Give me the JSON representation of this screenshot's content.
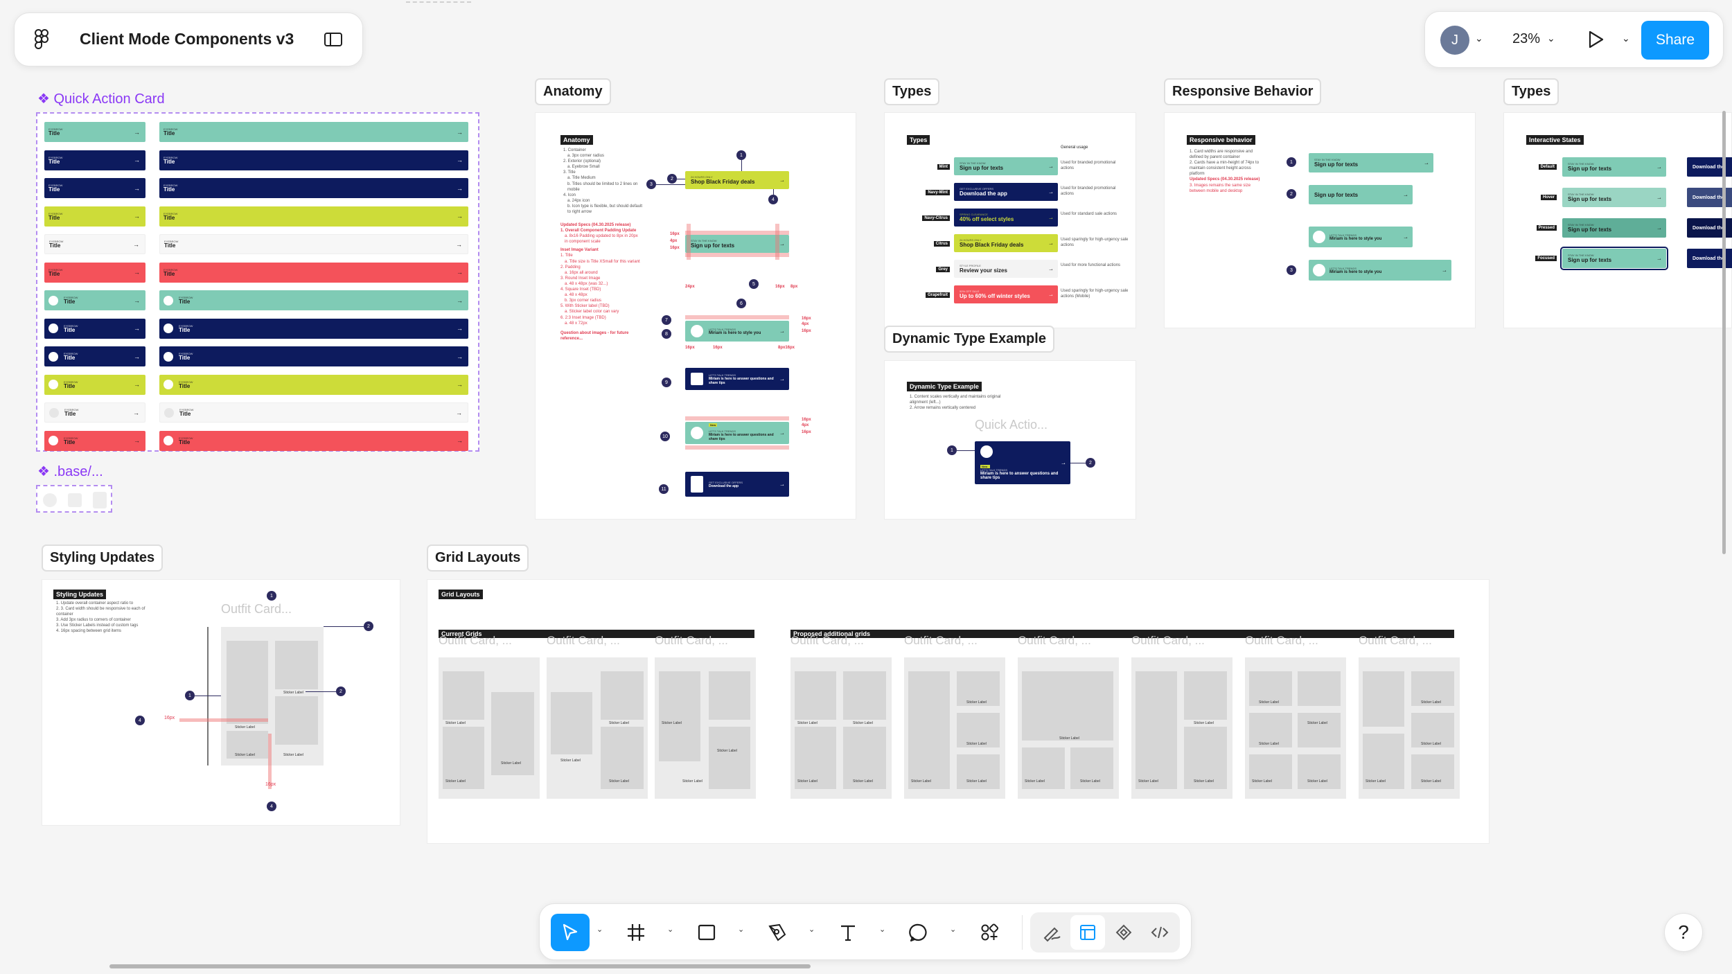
{
  "header": {
    "file_title": "Client Mode Components v3"
  },
  "topright": {
    "avatar_initial": "J",
    "zoom": "23%",
    "share_label": "Share"
  },
  "frames": {
    "quick_action": "Quick Action Card",
    "base": ".base/...",
    "anatomy": "Anatomy",
    "types": "Types",
    "responsive": "Responsive Behavior",
    "types2": "Types",
    "dynamic": "Dynamic Type Example",
    "styling": "Styling Updates",
    "grid": "Grid Layouts"
  },
  "quick_cards": {
    "eyebrow": "EYEBROW",
    "title": "Title",
    "arrow": "→"
  },
  "anatomy": {
    "title": "Anatomy",
    "notes": [
      "1. Container",
      "a. 3px corner radius",
      "2. Exterior (optional)",
      "a. Eyebrow Small",
      "3. Title",
      "a. Title Medium",
      "b. Titles should be limited to 2 lines on mobile",
      "4. Icon",
      "a. 24px icon",
      "b. Icon type is flexible, but should default to right arrow"
    ],
    "red_notes": [
      "Updated Specs (04.30.2025 release)",
      "1. Overall Component Padding Update",
      "a. 8x16 Padding updated to 8px in 20px in component scale",
      "Inset Image Variant",
      "1. Title",
      "a. Title size is Title XSmall for this variant",
      "2. Padding",
      "a. 16px all around",
      "3. Round Inset Image",
      "a. 48 x 48px (was 32...)",
      "4. Square Inset (TBD)",
      "a. 48 x 48px",
      "b. 3px corner radius",
      "5. With Sticker label (TBD)",
      "a. Sticker label color can vary",
      "6. 2:3 Inset Image (TBD)",
      "a. 48 x 72px",
      "Question about images - for future reference..."
    ],
    "cards": [
      {
        "eb": "24 HOURS ONLY",
        "title": "Shop Black Friday deals"
      },
      {
        "eb": "STAY IN THE KNOW",
        "title": "Sign up for texts"
      },
      {
        "eb": "LET'S TALK TRENDS",
        "title": "Miriam is here to style you"
      },
      {
        "eb": "LET'S TALK TRENDS",
        "title": "Miriam is here to answer questions and share tips"
      },
      {
        "eb": "LET'S TALK TRENDS",
        "title": "Miriam is here to answer questions and share tips"
      },
      {
        "eb": "GET EXCLUSIVE OFFERS",
        "title": "Download the app"
      }
    ],
    "measures": [
      "16px",
      "4px",
      "16px",
      "24px",
      "16px",
      "8px",
      "16px",
      "4px",
      "16px",
      "16px",
      "16px",
      "8px16px",
      "16px",
      "4px",
      "16px"
    ],
    "sticker": "New"
  },
  "types": {
    "title": "Types",
    "header_note": "General usage",
    "rows": [
      {
        "tag": "Mint",
        "eb": "STAY IN THE KNOW",
        "title": "Sign up for texts",
        "note": "Used for branded promotional actions"
      },
      {
        "tag": "Navy-Mint",
        "eb": "GET EXCLUSIVE OFFERS",
        "title": "Download the app",
        "note": "Used for branded promotional actions"
      },
      {
        "tag": "Navy-Citrus",
        "eb": "SPRING CLEARANCE",
        "title": "40% off select styles",
        "note": "Used for standard sale actions"
      },
      {
        "tag": "Citrus",
        "eb": "24 HOURS ONLY",
        "title": "Shop Black Friday deals",
        "note": "Used sparingly for high-urgency sale actions"
      },
      {
        "tag": "Grey",
        "eb": "STYLE PROFILE",
        "title": "Review your sizes",
        "note": "Used for more functional actions"
      },
      {
        "tag": "Grapefruit",
        "eb": "50% OFF SALE",
        "title": "Up to 60% off winter styles",
        "note": "Used sparingly for high-urgency sale actions (Mobile)"
      }
    ]
  },
  "responsive": {
    "title": "Responsive behavior",
    "notes": [
      "1. Card widths are responsive and defined by parent container",
      "2. Cards have a min-height of 74px to maintain consistent height across platform"
    ],
    "red_notes": [
      "Updated Specs (04.30.2025 release)",
      "3. Images remains the same size between mobile and desktop"
    ],
    "cards": [
      {
        "eb": "STAY IN THE KNOW",
        "title": "Sign up for texts"
      },
      {
        "eb": "",
        "title": "Sign up for texts"
      },
      {
        "eb": "LET'S TALK TRENDS",
        "title": "Miriam is here to style you"
      },
      {
        "eb": "LET'S TALK TRENDS",
        "title": "Miriam is here to style you"
      }
    ]
  },
  "interactive": {
    "title": "Interactive States",
    "rows": [
      {
        "tag": "Default",
        "eb": "STAY IN THE KNOW",
        "title": "Sign up for texts",
        "side": "Download the"
      },
      {
        "tag": "Hover",
        "eb": "STAY IN THE KNOW",
        "title": "Sign up for texts",
        "side": "Download the"
      },
      {
        "tag": "Pressed",
        "eb": "STAY IN THE KNOW",
        "title": "Sign up for texts",
        "side": "Download the"
      },
      {
        "tag": "Focused",
        "eb": "STAY IN THE KNOW",
        "title": "Sign up for texts",
        "side": "Download the"
      }
    ]
  },
  "dynamic": {
    "title": "Dynamic Type Example",
    "notes": [
      "1. Content scales vertically and maintains original alignment (left...)",
      "2. Arrow remains vertically centered"
    ],
    "ghost": "Quick Actio...",
    "card": {
      "eb": "LET'S TALK TRENDS",
      "title": "Miriam is here to answer questions and share tips",
      "sticker": "New"
    }
  },
  "styling": {
    "title": "Styling Updates",
    "notes": [
      "1. Update overall container aspect ratio to",
      "2. 3. Card width should be responsive to each of container",
      "3. Add 3px radius to corners of container",
      "3. Use Sticker Labels instead of custom tags",
      "4. 16px spacing between grid items"
    ],
    "ghost": "Outfit Card...",
    "measure1": "16px",
    "measure2": "16px",
    "sticker": "Sticker Label"
  },
  "grid": {
    "title": "Grid Layouts",
    "current": "Current Grids",
    "proposed": "Proposed additional grids",
    "ghost": "Outfit Card, ...",
    "sticker": "Sticker Label"
  }
}
